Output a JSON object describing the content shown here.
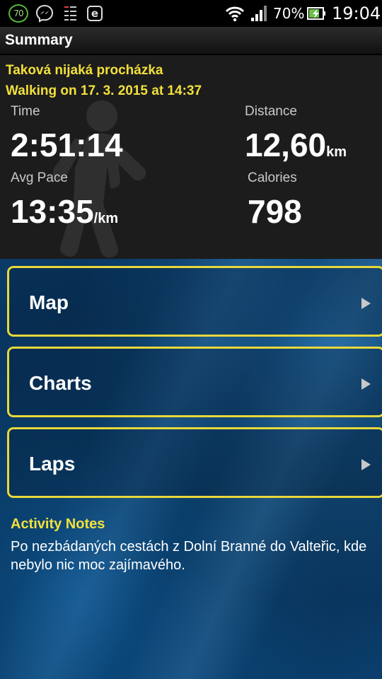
{
  "status_bar": {
    "battery_badge": "70",
    "battery_percent": "70%",
    "clock": "19:04",
    "icons": [
      "battery-level-badge-icon",
      "messenger-icon",
      "task-list-icon",
      "e-app-icon",
      "wifi-icon",
      "signal-icon",
      "battery-charging-icon"
    ],
    "e_app_letter": "e"
  },
  "header": {
    "title": "Summary"
  },
  "activity": {
    "name": "Taková nijaká procházka",
    "date_line": "Walking on 17. 3. 2015 at 14:37"
  },
  "stats": {
    "time_label": "Time",
    "time_value": "2:51:14",
    "distance_label": "Distance",
    "distance_value": "12,60",
    "distance_unit": "km",
    "pace_label": "Avg Pace",
    "pace_value": "13:35",
    "pace_unit": "/km",
    "calories_label": "Calories",
    "calories_value": "798"
  },
  "menu": {
    "items": [
      {
        "label": "Map"
      },
      {
        "label": "Charts"
      },
      {
        "label": "Laps"
      }
    ]
  },
  "notes": {
    "heading": "Activity Notes",
    "text": "Po nezbádaných cestách z Dolní Branné do Valteřic, kde nebylo nic moc zajímavého."
  },
  "colors": {
    "accent_yellow": "#f2e03c",
    "button_border": "#e8d83a",
    "panel_bg": "#1c1c1c",
    "background_blue": "#062a4a"
  }
}
